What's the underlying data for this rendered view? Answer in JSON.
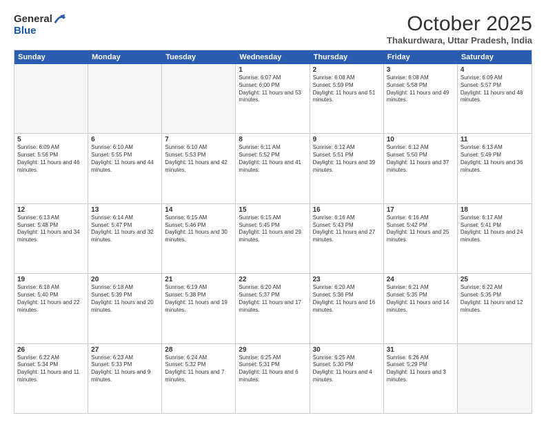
{
  "logo": {
    "general": "General",
    "blue": "Blue"
  },
  "header": {
    "month": "October 2025",
    "location": "Thakurdwara, Uttar Pradesh, India"
  },
  "weekdays": [
    "Sunday",
    "Monday",
    "Tuesday",
    "Wednesday",
    "Thursday",
    "Friday",
    "Saturday"
  ],
  "rows": [
    [
      {
        "day": "",
        "text": ""
      },
      {
        "day": "",
        "text": ""
      },
      {
        "day": "",
        "text": ""
      },
      {
        "day": "1",
        "text": "Sunrise: 6:07 AM\nSunset: 6:00 PM\nDaylight: 11 hours and 53 minutes."
      },
      {
        "day": "2",
        "text": "Sunrise: 6:08 AM\nSunset: 5:59 PM\nDaylight: 11 hours and 51 minutes."
      },
      {
        "day": "3",
        "text": "Sunrise: 6:08 AM\nSunset: 5:58 PM\nDaylight: 11 hours and 49 minutes."
      },
      {
        "day": "4",
        "text": "Sunrise: 6:09 AM\nSunset: 5:57 PM\nDaylight: 11 hours and 48 minutes."
      }
    ],
    [
      {
        "day": "5",
        "text": "Sunrise: 6:09 AM\nSunset: 5:56 PM\nDaylight: 11 hours and 46 minutes."
      },
      {
        "day": "6",
        "text": "Sunrise: 6:10 AM\nSunset: 5:55 PM\nDaylight: 11 hours and 44 minutes."
      },
      {
        "day": "7",
        "text": "Sunrise: 6:10 AM\nSunset: 5:53 PM\nDaylight: 11 hours and 42 minutes."
      },
      {
        "day": "8",
        "text": "Sunrise: 6:11 AM\nSunset: 5:52 PM\nDaylight: 11 hours and 41 minutes."
      },
      {
        "day": "9",
        "text": "Sunrise: 6:12 AM\nSunset: 5:51 PM\nDaylight: 11 hours and 39 minutes."
      },
      {
        "day": "10",
        "text": "Sunrise: 6:12 AM\nSunset: 5:50 PM\nDaylight: 11 hours and 37 minutes."
      },
      {
        "day": "11",
        "text": "Sunrise: 6:13 AM\nSunset: 5:49 PM\nDaylight: 11 hours and 36 minutes."
      }
    ],
    [
      {
        "day": "12",
        "text": "Sunrise: 6:13 AM\nSunset: 5:48 PM\nDaylight: 11 hours and 34 minutes."
      },
      {
        "day": "13",
        "text": "Sunrise: 6:14 AM\nSunset: 5:47 PM\nDaylight: 11 hours and 32 minutes."
      },
      {
        "day": "14",
        "text": "Sunrise: 6:15 AM\nSunset: 5:46 PM\nDaylight: 11 hours and 30 minutes."
      },
      {
        "day": "15",
        "text": "Sunrise: 6:15 AM\nSunset: 5:45 PM\nDaylight: 11 hours and 29 minutes."
      },
      {
        "day": "16",
        "text": "Sunrise: 6:16 AM\nSunset: 5:43 PM\nDaylight: 11 hours and 27 minutes."
      },
      {
        "day": "17",
        "text": "Sunrise: 6:16 AM\nSunset: 5:42 PM\nDaylight: 11 hours and 25 minutes."
      },
      {
        "day": "18",
        "text": "Sunrise: 6:17 AM\nSunset: 5:41 PM\nDaylight: 11 hours and 24 minutes."
      }
    ],
    [
      {
        "day": "19",
        "text": "Sunrise: 6:18 AM\nSunset: 5:40 PM\nDaylight: 11 hours and 22 minutes."
      },
      {
        "day": "20",
        "text": "Sunrise: 6:18 AM\nSunset: 5:39 PM\nDaylight: 11 hours and 20 minutes."
      },
      {
        "day": "21",
        "text": "Sunrise: 6:19 AM\nSunset: 5:38 PM\nDaylight: 11 hours and 19 minutes."
      },
      {
        "day": "22",
        "text": "Sunrise: 6:20 AM\nSunset: 5:37 PM\nDaylight: 11 hours and 17 minutes."
      },
      {
        "day": "23",
        "text": "Sunrise: 6:20 AM\nSunset: 5:36 PM\nDaylight: 11 hours and 16 minutes."
      },
      {
        "day": "24",
        "text": "Sunrise: 6:21 AM\nSunset: 5:35 PM\nDaylight: 11 hours and 14 minutes."
      },
      {
        "day": "25",
        "text": "Sunrise: 6:22 AM\nSunset: 5:35 PM\nDaylight: 11 hours and 12 minutes."
      }
    ],
    [
      {
        "day": "26",
        "text": "Sunrise: 6:22 AM\nSunset: 5:34 PM\nDaylight: 11 hours and 11 minutes."
      },
      {
        "day": "27",
        "text": "Sunrise: 6:23 AM\nSunset: 5:33 PM\nDaylight: 11 hours and 9 minutes."
      },
      {
        "day": "28",
        "text": "Sunrise: 6:24 AM\nSunset: 5:32 PM\nDaylight: 11 hours and 7 minutes."
      },
      {
        "day": "29",
        "text": "Sunrise: 6:25 AM\nSunset: 5:31 PM\nDaylight: 11 hours and 6 minutes."
      },
      {
        "day": "30",
        "text": "Sunrise: 6:25 AM\nSunset: 5:30 PM\nDaylight: 11 hours and 4 minutes."
      },
      {
        "day": "31",
        "text": "Sunrise: 6:26 AM\nSunset: 5:29 PM\nDaylight: 11 hours and 3 minutes."
      },
      {
        "day": "",
        "text": ""
      }
    ]
  ]
}
